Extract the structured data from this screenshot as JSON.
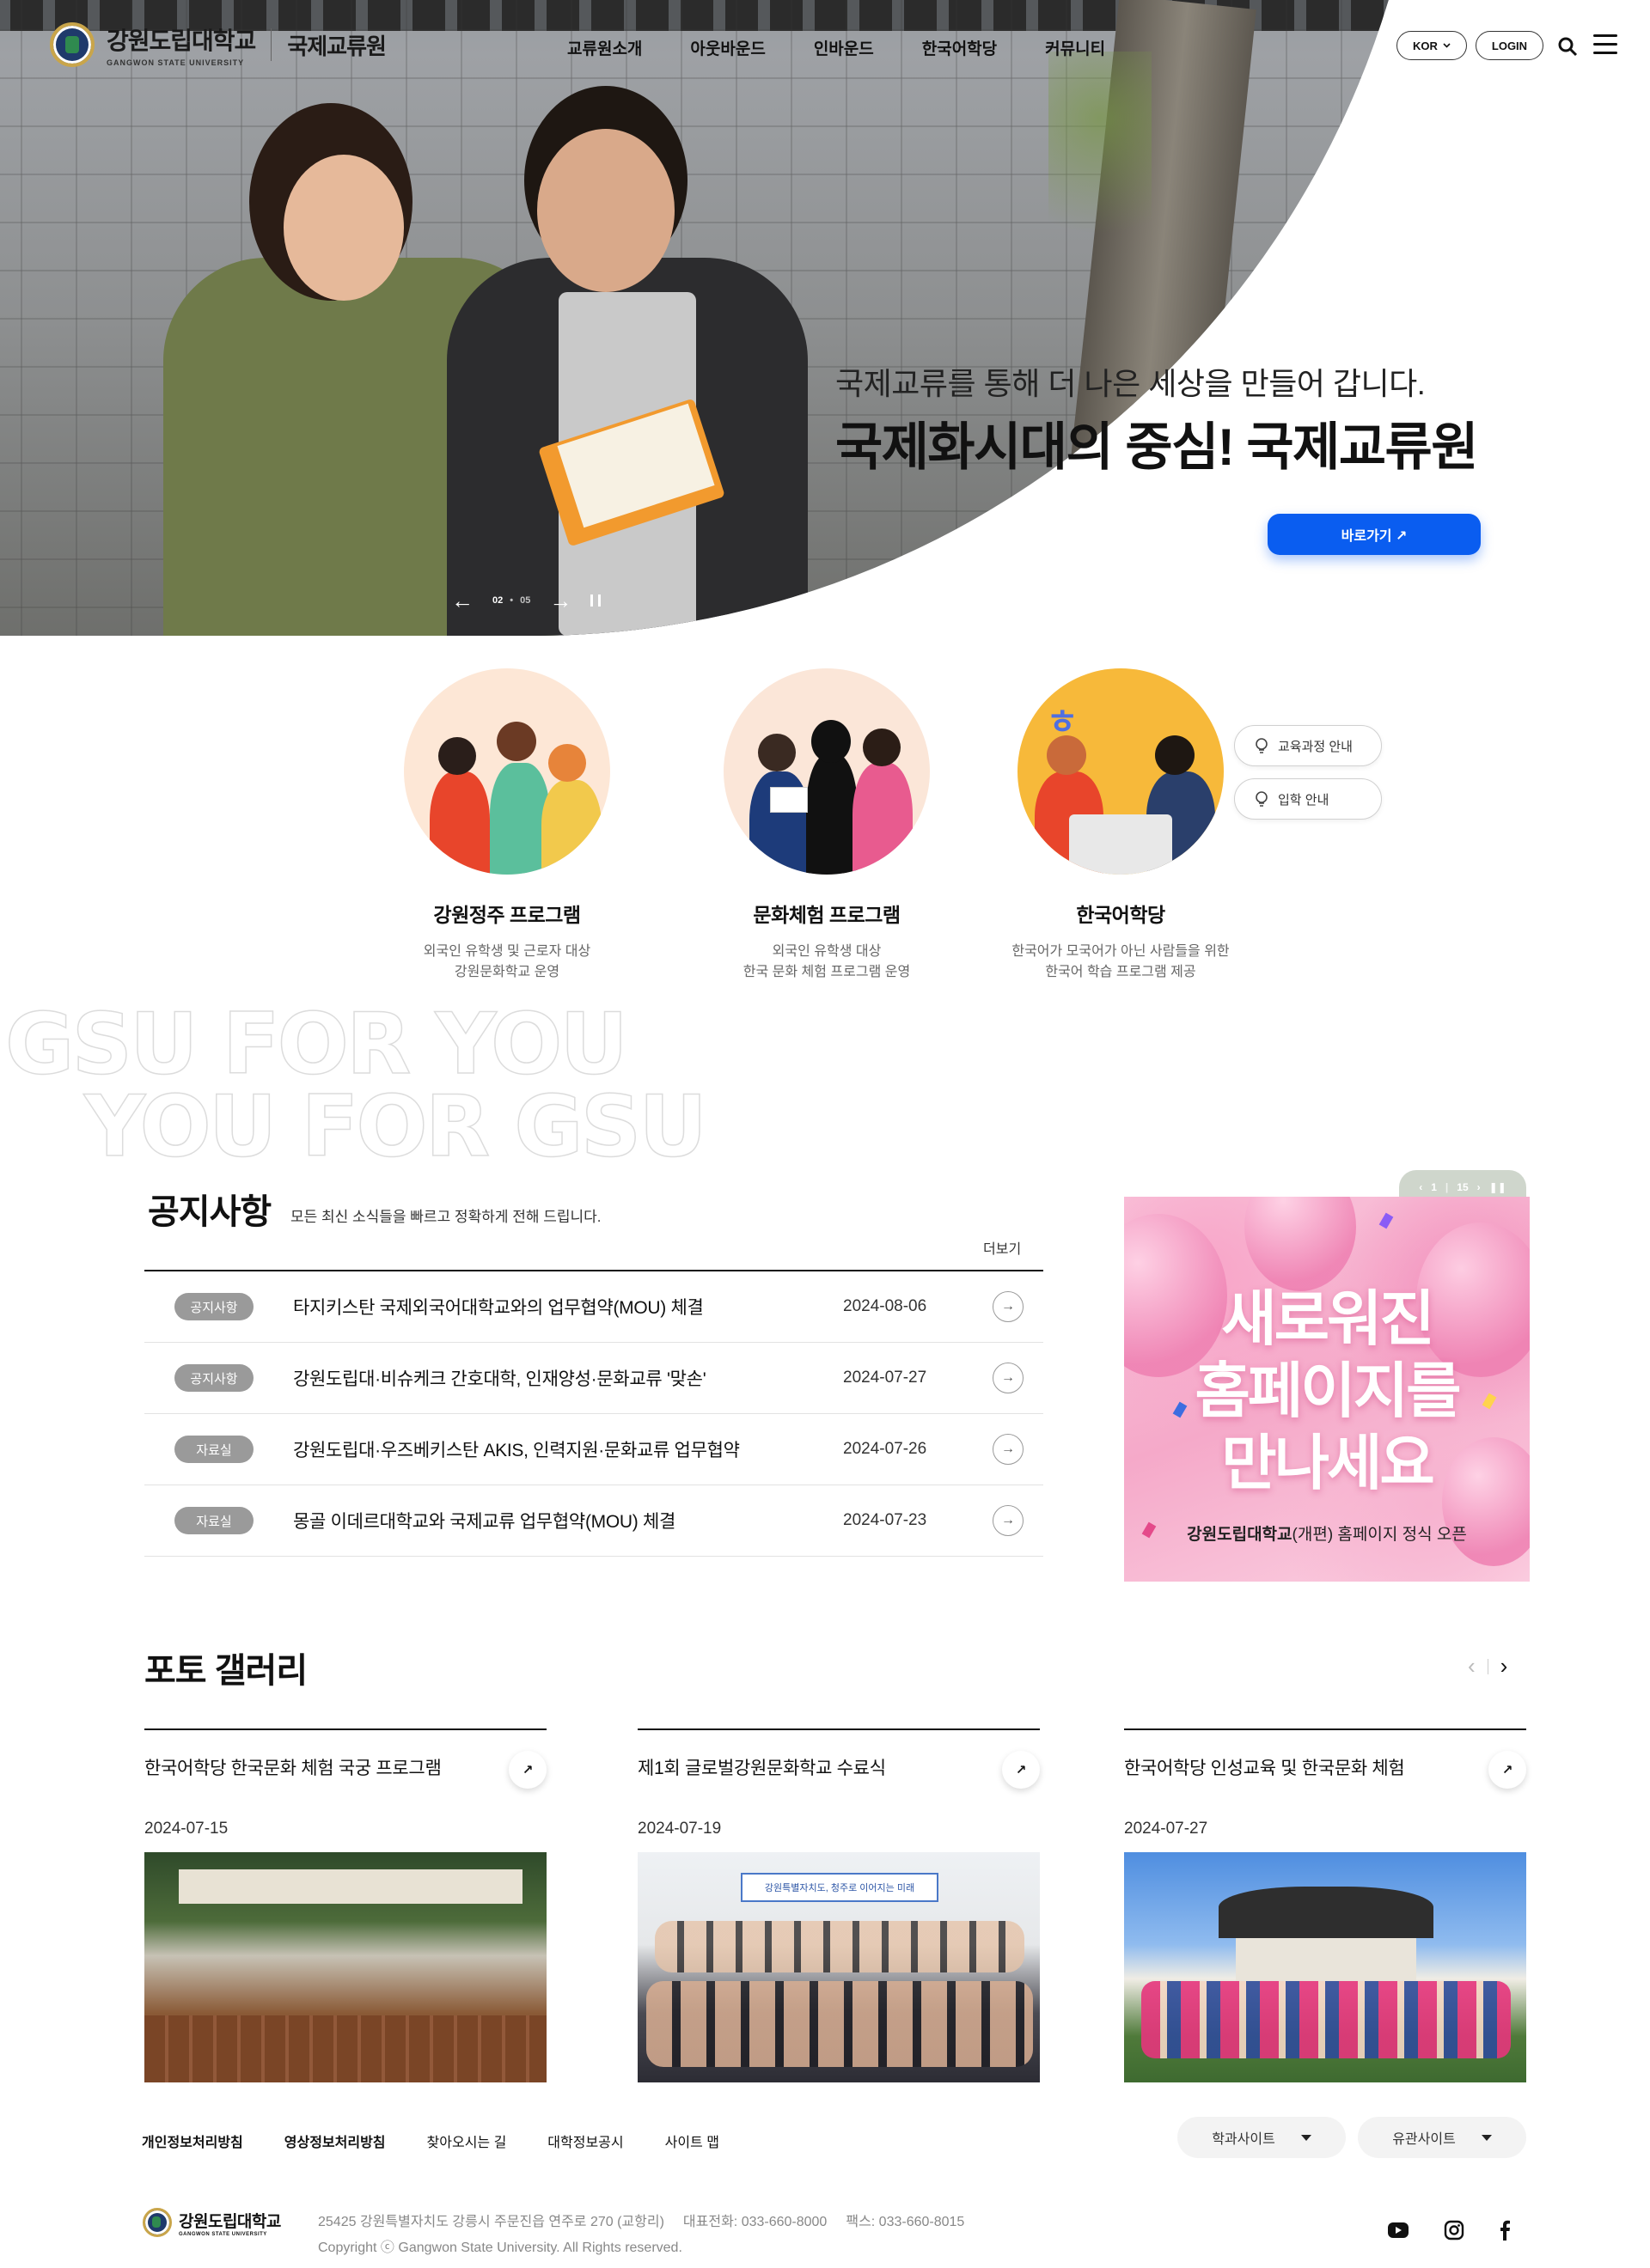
{
  "header": {
    "logo_kr": "강원도립대학교",
    "logo_en": "GANGWON STATE UNIVERSITY",
    "site_name": "국제교류원",
    "nav": [
      "교류원소개",
      "아웃바운드",
      "인바운드",
      "한국어학당",
      "커뮤니티"
    ],
    "lang": "KOR",
    "login": "LOGIN",
    "icons": [
      "search-icon",
      "hamburger-menu-icon"
    ]
  },
  "hero": {
    "subtitle": "국제교류를 통해 더 나은 세상을 만들어 갑니다.",
    "title": "국제화시대의 중심! 국제교류원",
    "button": "바로가기 ↗",
    "current_slide": "02",
    "total_slides": "05"
  },
  "programs": [
    {
      "title": "강원정주 프로그램",
      "desc1": "외국인 유학생 및 근로자 대상",
      "desc2": "강원문화학교 운영"
    },
    {
      "title": "문화체험 프로그램",
      "desc1": "외국인 유학생 대상",
      "desc2": "한국 문화 체험 프로그램 운영"
    },
    {
      "title": "한국어학당",
      "desc1": "한국어가 모국어가 아닌 사람들을 위한",
      "desc2": "한국어 학습 프로그램 제공"
    }
  ],
  "quick_links": [
    "교육과정 안내",
    "입학 안내"
  ],
  "slogan": [
    "GSU FOR YOU",
    "YOU FOR GSU"
  ],
  "notice": {
    "title": "공지사항",
    "description": "모든 최신 소식들을 빠르고 정확하게 전해 드립니다.",
    "more": "더보기",
    "rows": [
      {
        "tag": "공지사항",
        "title": "타지키스탄 국제외국어대학교와의 업무협약(MOU) 체결",
        "date": "2024-08-06"
      },
      {
        "tag": "공지사항",
        "title": "강원도립대·비슈케크 간호대학, 인재양성·문화교류 '맞손'",
        "date": "2024-07-27"
      },
      {
        "tag": "자료실",
        "title": "강원도립대·우즈베키스탄 AKIS, 인력지원·문화교류 업무협약",
        "date": "2024-07-26"
      },
      {
        "tag": "자료실",
        "title": "몽골 이데르대학교와 국제교류 업무협약(MOU) 체결",
        "date": "2024-07-23"
      }
    ]
  },
  "banner": {
    "current": "1",
    "total": "15",
    "headline": [
      "새로워진",
      "홈페이지를",
      "만나세요"
    ],
    "caption_bold": "강원도립대학교",
    "caption_rest": "(개편) 홈페이지 정식 오픈"
  },
  "gallery": {
    "title": "포토 갤러리",
    "items": [
      {
        "title": "한국어학당 한국문화 체험 국궁 프로그램",
        "date": "2024-07-15"
      },
      {
        "title": "제1회 글로벌강원문화학교 수료식",
        "date": "2024-07-19"
      },
      {
        "title": "한국어학당 인성교육 및 한국문화 체험",
        "date": "2024-07-27"
      }
    ],
    "photo2_banner": "강원특별자치도, 청주로 이어지는 미래"
  },
  "footer": {
    "links": [
      "개인정보처리방침",
      "영상정보처리방침",
      "찾아오시는 길",
      "대학정보공시",
      "사이트 맵"
    ],
    "selects": [
      "학과사이트",
      "유관사이트"
    ],
    "address": "25425 강원특별자치도 강릉시 주문진읍 연주로 270 (교항리)",
    "phone": "대표전화: 033-660-8000",
    "fax": "팩스: 033-660-8015",
    "copyright": "Copyright ⓒ Gangwon State University. All Rights reserved.",
    "social": [
      "youtube-icon",
      "instagram-icon",
      "facebook-icon"
    ]
  },
  "colors": {
    "accent": "#0a5df0",
    "tag": "#9a9a9a",
    "banner_pink": "#f5a9c9"
  }
}
